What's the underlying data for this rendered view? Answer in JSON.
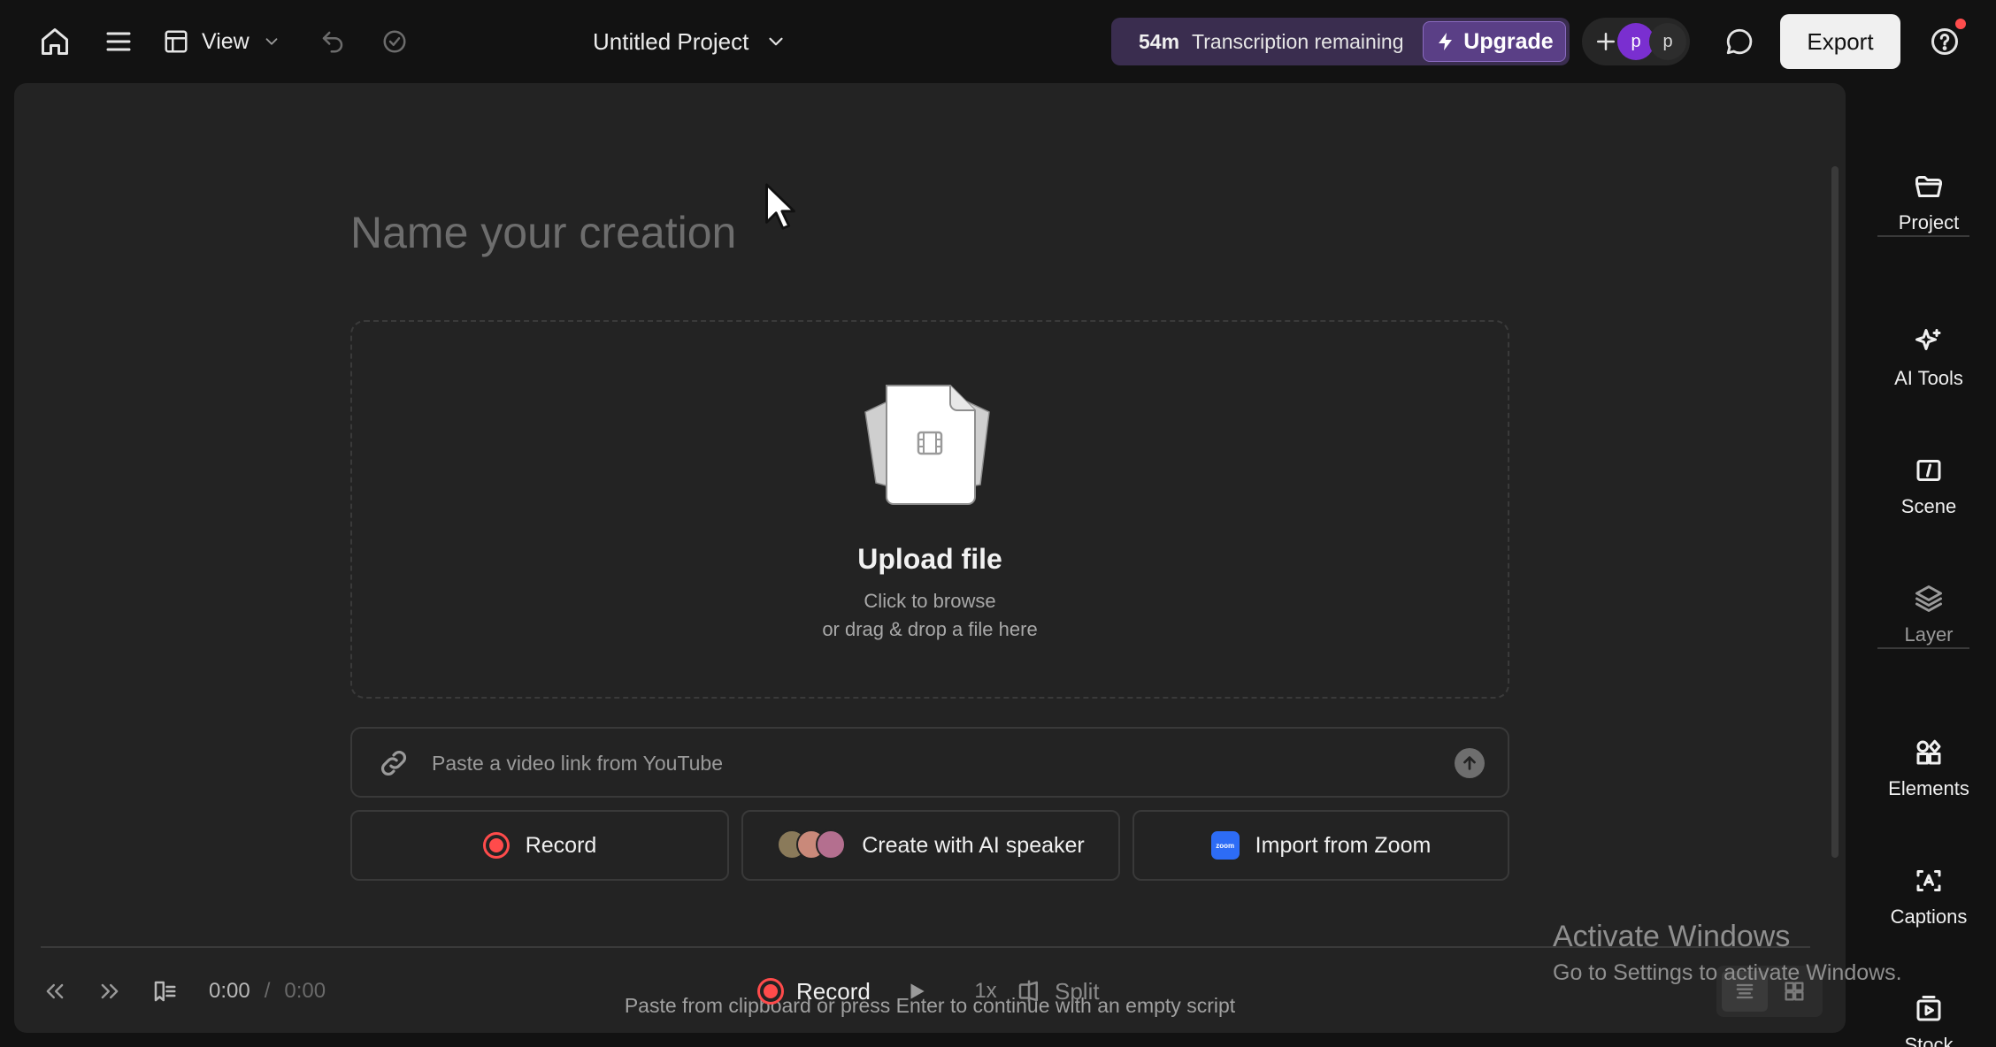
{
  "topbar": {
    "view_label": "View",
    "project_title": "Untitled Project",
    "transcription": {
      "minutes": "54m",
      "label": "Transcription remaining"
    },
    "upgrade_label": "Upgrade",
    "collaborators": [
      "p",
      "p"
    ],
    "export_label": "Export"
  },
  "main": {
    "name_placeholder": "Name your creation",
    "upload": {
      "title": "Upload file",
      "line1": "Click to browse",
      "line2": "or drag & drop a file here"
    },
    "link_placeholder": "Paste a video link from YouTube",
    "actions": {
      "record": "Record",
      "ai_speaker": "Create with AI speaker",
      "zoom": "Import from Zoom",
      "zoom_logo": "zoom"
    },
    "hint": "Paste from clipboard or press Enter to continue with an empty script"
  },
  "transport": {
    "current_time": "0:00",
    "separator": "/",
    "total_time": "0:00",
    "record_label": "Record",
    "speed": "1x",
    "split_label": "Split"
  },
  "right_rail": {
    "items": [
      {
        "label": "Project",
        "icon": "folder-icon"
      },
      {
        "label": "AI Tools",
        "icon": "sparkle-icon"
      },
      {
        "label": "Scene",
        "icon": "scene-icon"
      },
      {
        "label": "Layer",
        "icon": "layers-icon"
      },
      {
        "label": "Elements",
        "icon": "shapes-icon"
      },
      {
        "label": "Captions",
        "icon": "captions-icon"
      },
      {
        "label": "Stock",
        "icon": "stock-media-icon"
      }
    ]
  },
  "watermark": {
    "title": "Activate Windows",
    "subtitle": "Go to Settings to activate Windows."
  },
  "colors": {
    "background": "#121212",
    "panel": "#232323",
    "upgrade_purple": "#5a3f86",
    "record_red": "#ff4b4b",
    "avatar_purple": "#7a2fd0",
    "zoom_blue": "#2d6cf6"
  }
}
